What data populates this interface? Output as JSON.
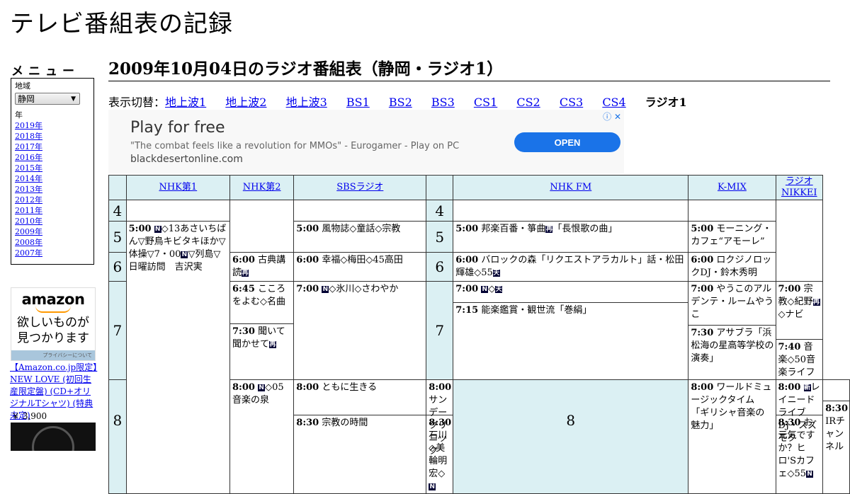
{
  "site": {
    "title": "テレビ番組表の記録"
  },
  "sidebar": {
    "menu_heading": "メニュー",
    "region_label": "地域",
    "region_value": "静岡",
    "year_label": "年",
    "years": [
      "2019年",
      "2018年",
      "2017年",
      "2016年",
      "2015年",
      "2014年",
      "2013年",
      "2012年",
      "2011年",
      "2010年",
      "2009年",
      "2008年",
      "2007年"
    ],
    "amazon": {
      "logo": "amazon",
      "tagline_1": "欲しいものが",
      "tagline_2": "見つかります",
      "privacy": "プライバシーについて"
    },
    "product": {
      "link": "【Amazon.co.jp限定】NEW LOVE (初回生産限定盤) (CD+オリジナルTシャツ) (特典未定)",
      "price": "￥ 3,900"
    }
  },
  "main": {
    "heading": "2009年10月04日のラジオ番組表（静岡・ラジオ1）",
    "switch_prefix": "表示切替：",
    "switch_links": [
      "地上波1",
      "地上波2",
      "地上波3",
      "BS1",
      "BS2",
      "BS3",
      "CS1",
      "CS2",
      "CS3",
      "CS4"
    ],
    "switch_current": "ラジオ1"
  },
  "ad": {
    "headline": "Play for free",
    "quote": "\"The combat feels like a revolution for MMOs\" - Eurogamer - Play on PC",
    "domain": "blackdesertonline.com",
    "button": "OPEN",
    "icons": "ⓘ ✕"
  },
  "schedule": {
    "channels": [
      "NHK第1",
      "NHK第2",
      "SBSラジオ",
      "NHK FM",
      "K-MIX",
      "ラジオNIKKEI"
    ],
    "hours": [
      "4",
      "5",
      "6",
      "7",
      "8"
    ],
    "programs": {
      "nhk1_500": {
        "time": "5:00",
        "a": "◇13あさいちばん▽野鳥キビタキほか▽体操▽7・00",
        "b": "▽列島▽日曜訪問　吉沢実"
      },
      "nhk1_800": {
        "time": "8:00",
        "a": "◇05音楽の泉"
      },
      "nhk2_600": {
        "time": "6:00",
        "a": "古典講読"
      },
      "nhk2_645": {
        "time": "6:45",
        "a": "こころをよむ◇名曲"
      },
      "nhk2_730": {
        "time": "7:30",
        "a": "聞いて聞かせて"
      },
      "nhk2_800": {
        "time": "8:00",
        "a": "ともに生きる"
      },
      "nhk2_830": {
        "time": "8:30",
        "a": "宗教の時間"
      },
      "sbs_500": {
        "time": "5:00",
        "a": "風物誌◇童話◇宗教"
      },
      "sbs_600": {
        "time": "6:00",
        "a": "幸福◇梅田◇45高田"
      },
      "sbs_700": {
        "time": "7:00",
        "a": "◇氷川◇さわやか"
      },
      "sbs_800": {
        "time": "8:00",
        "a": "サンデークリニック"
      },
      "sbs_830": {
        "time": "8:30",
        "a": "石川◇美輪明宏◇"
      },
      "fm_500": {
        "time": "5:00",
        "a": "邦楽百番・箏曲",
        "b": "「長恨歌の曲」"
      },
      "fm_600": {
        "time": "6:00",
        "a": "バロックの森「リクエストアラカルト」話・松田輝雄◇55"
      },
      "fm_700": {
        "time": "7:00",
        "a": "◇"
      },
      "fm_715": {
        "time": "7:15",
        "a": "能楽鑑賞・観世流「巻絹」"
      },
      "fm_800": {
        "time": "8:00",
        "a": "ワールドミュージックタイム「ギリシャ音楽の魅力」"
      },
      "kmix_500": {
        "time": "5:00",
        "a": "モーニング・カフェ“アモーレ”"
      },
      "kmix_600": {
        "time": "6:00",
        "a": "ロクジノロックDJ・鈴木秀明"
      },
      "kmix_700": {
        "time": "7:00",
        "a": "やうこのアルデンテ・ルームやうこ"
      },
      "kmix_730": {
        "time": "7:30",
        "a": "アサブラ「浜松海の星高等学校の演奏」"
      },
      "kmix_800": {
        "time": "8:00",
        "a": "レイニードライブDJ・スズモク"
      },
      "kmix_830": {
        "time": "8:30",
        "a": "お元気ですか？ヒロ'Sカフェ◇55"
      },
      "nikkei_700": {
        "time": "7:00",
        "a": "宗教◇紀野",
        "b": "◇ナビ"
      },
      "nikkei_740": {
        "time": "7:40",
        "a": "音楽◇50音楽ライフ"
      },
      "nikkei_830": {
        "time": "8:30",
        "a": "IRチャンネル"
      }
    },
    "marks": {
      "news": "N",
      "rebroadcast": "再",
      "weather": "天",
      "new": "新"
    }
  }
}
